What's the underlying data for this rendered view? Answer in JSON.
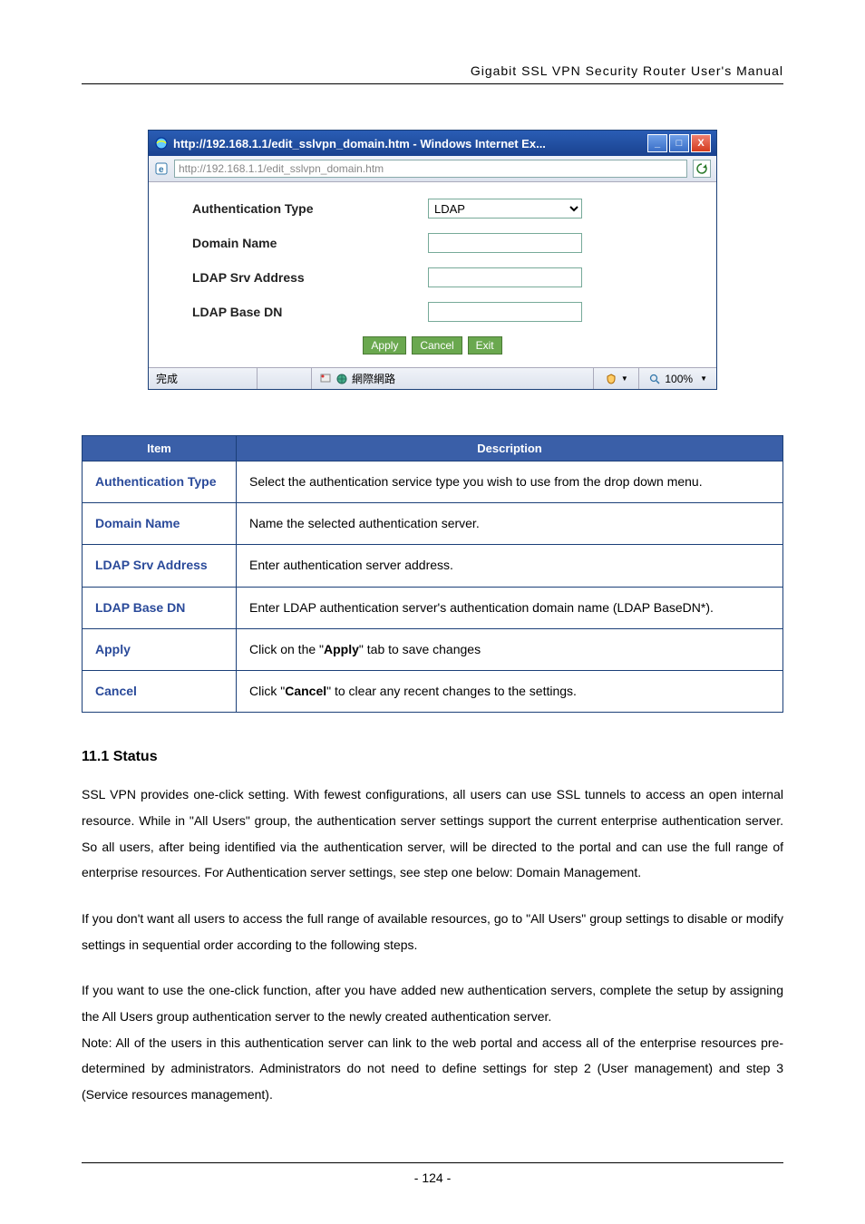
{
  "header": {
    "title": "Gigabit  SSL  VPN  Security  Router  User's  Manual"
  },
  "browser": {
    "title": "http://192.168.1.1/edit_sslvpn_domain.htm - Windows Internet Ex...",
    "address_prefix": "http://",
    "address_bold": "192.168.1.1",
    "address_rest": "/edit_sslvpn_domain.htm",
    "min": "_",
    "max": "□",
    "close": "X",
    "form": {
      "auth_label": "Authentication Type",
      "auth_value": "LDAP",
      "domain_label": "Domain Name",
      "domain_value": "",
      "srv_label": "LDAP Srv Address",
      "srv_value": "",
      "basedn_label": "LDAP Base DN",
      "basedn_value": "",
      "apply": "Apply",
      "cancel": "Cancel",
      "exit": "Exit"
    },
    "status": {
      "done": "完成",
      "net": "網際網路",
      "zoom": "100%"
    }
  },
  "table": {
    "h1": "Item",
    "h2": "Description",
    "rows": [
      {
        "k": "Authentication Type",
        "v": "Select the authentication service type you wish to use from the drop down menu."
      },
      {
        "k": "Domain Name",
        "v": "Name the selected authentication server."
      },
      {
        "k": "LDAP Srv Address",
        "v": "Enter authentication server address."
      },
      {
        "k": "LDAP Base DN",
        "v": "Enter LDAP authentication server's authentication domain name (LDAP BaseDN*)."
      },
      {
        "k": "Apply",
        "v_pre": "Click on the \"",
        "v_bold": "Apply",
        "v_post": "\" tab to save changes"
      },
      {
        "k": "Cancel",
        "v_pre": "Click \"",
        "v_bold": "Cancel",
        "v_post": "\" to clear any recent changes to the settings."
      }
    ]
  },
  "section": {
    "title": "11.1 Status"
  },
  "paras": {
    "p1": "SSL VPN provides one-click setting. With fewest configurations, all users can use SSL tunnels to access an open internal resource. While in \"All Users\" group, the authentication server settings support the current enterprise authentication server. So all users, after being identified via the authentication server, will be directed to the portal and can use the full range of enterprise resources. For Authentication server settings, see step one below: Domain Management.",
    "p2": "If you don't want all users to access the full range of available resources, go to \"All Users\" group settings to disable or modify settings in sequential order according to the following steps.",
    "p3": "If you want to use the one-click function, after you have added new authentication servers, complete the setup by assigning the All Users group authentication server to the newly created authentication server.",
    "p4": "Note: All of the users in this authentication server can link to the web portal and access all of the enterprise resources pre-determined by administrators. Administrators do not need to define settings for step 2 (User management) and step 3 (Service resources management)."
  },
  "footer": {
    "page": "- 124 -"
  }
}
